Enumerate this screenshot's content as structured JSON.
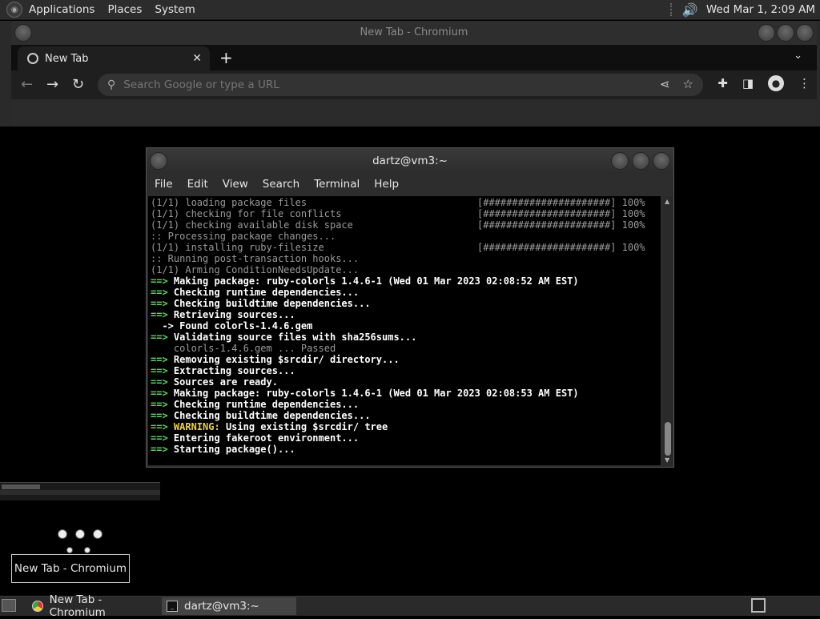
{
  "top_panel": {
    "menus": [
      "Applications",
      "Places",
      "System"
    ],
    "clock": "Wed Mar 1, 2:09 AM"
  },
  "chromium": {
    "window_title": "New Tab - Chromium",
    "tab_label": "New Tab",
    "omnibox_placeholder": "Search Google or type a URL"
  },
  "terminal": {
    "window_title": "dartz@vm3:~",
    "menu": [
      "File",
      "Edit",
      "View",
      "Search",
      "Terminal",
      "Help"
    ],
    "lines": [
      {
        "style": "dim",
        "text": "(1/1) loading package files",
        "bar": "[######################] 100%"
      },
      {
        "style": "dim",
        "text": "(1/1) checking for file conflicts",
        "bar": "[######################] 100%"
      },
      {
        "style": "dim",
        "text": "(1/1) checking available disk space",
        "bar": "[######################] 100%"
      },
      {
        "style": "dim",
        "text": ":: Processing package changes..."
      },
      {
        "style": "dim",
        "text": "(1/1) installing ruby-filesize",
        "bar": "[######################] 100%"
      },
      {
        "style": "dim",
        "text": ":: Running post-transaction hooks..."
      },
      {
        "style": "dim",
        "text": "(1/1) Arming ConditionNeedsUpdate..."
      },
      {
        "style": "arrow",
        "text": "Making package: ruby-colorls 1.4.6-1 (Wed 01 Mar 2023 02:08:52 AM EST)"
      },
      {
        "style": "arrow",
        "text": "Checking runtime dependencies..."
      },
      {
        "style": "arrow",
        "text": "Checking buildtime dependencies..."
      },
      {
        "style": "arrow",
        "text": "Retrieving sources..."
      },
      {
        "style": "sub",
        "text": "  -> Found colorls-1.4.6.gem"
      },
      {
        "style": "arrow",
        "text": "Validating source files with sha256sums..."
      },
      {
        "style": "dim",
        "text": "    colorls-1.4.6.gem ... Passed"
      },
      {
        "style": "arrow",
        "text": "Removing existing $srcdir/ directory..."
      },
      {
        "style": "arrow",
        "text": "Extracting sources..."
      },
      {
        "style": "arrow",
        "text": "Sources are ready."
      },
      {
        "style": "arrow",
        "text": "Making package: ruby-colorls 1.4.6-1 (Wed 01 Mar 2023 02:08:53 AM EST)"
      },
      {
        "style": "arrow",
        "text": "Checking runtime dependencies..."
      },
      {
        "style": "arrow",
        "text": "Checking buildtime dependencies..."
      },
      {
        "style": "warn",
        "text": "Using existing $srcdir/ tree",
        "warn_label": "WARNING:"
      },
      {
        "style": "arrow",
        "text": "Entering fakeroot environment..."
      },
      {
        "style": "arrow",
        "text": "Starting package()..."
      }
    ],
    "arrow_glyph": "==>"
  },
  "switcher_tooltip": "New Tab - Chromium",
  "taskbar": {
    "items": [
      "New Tab - Chromium",
      "dartz@vm3:~"
    ]
  }
}
